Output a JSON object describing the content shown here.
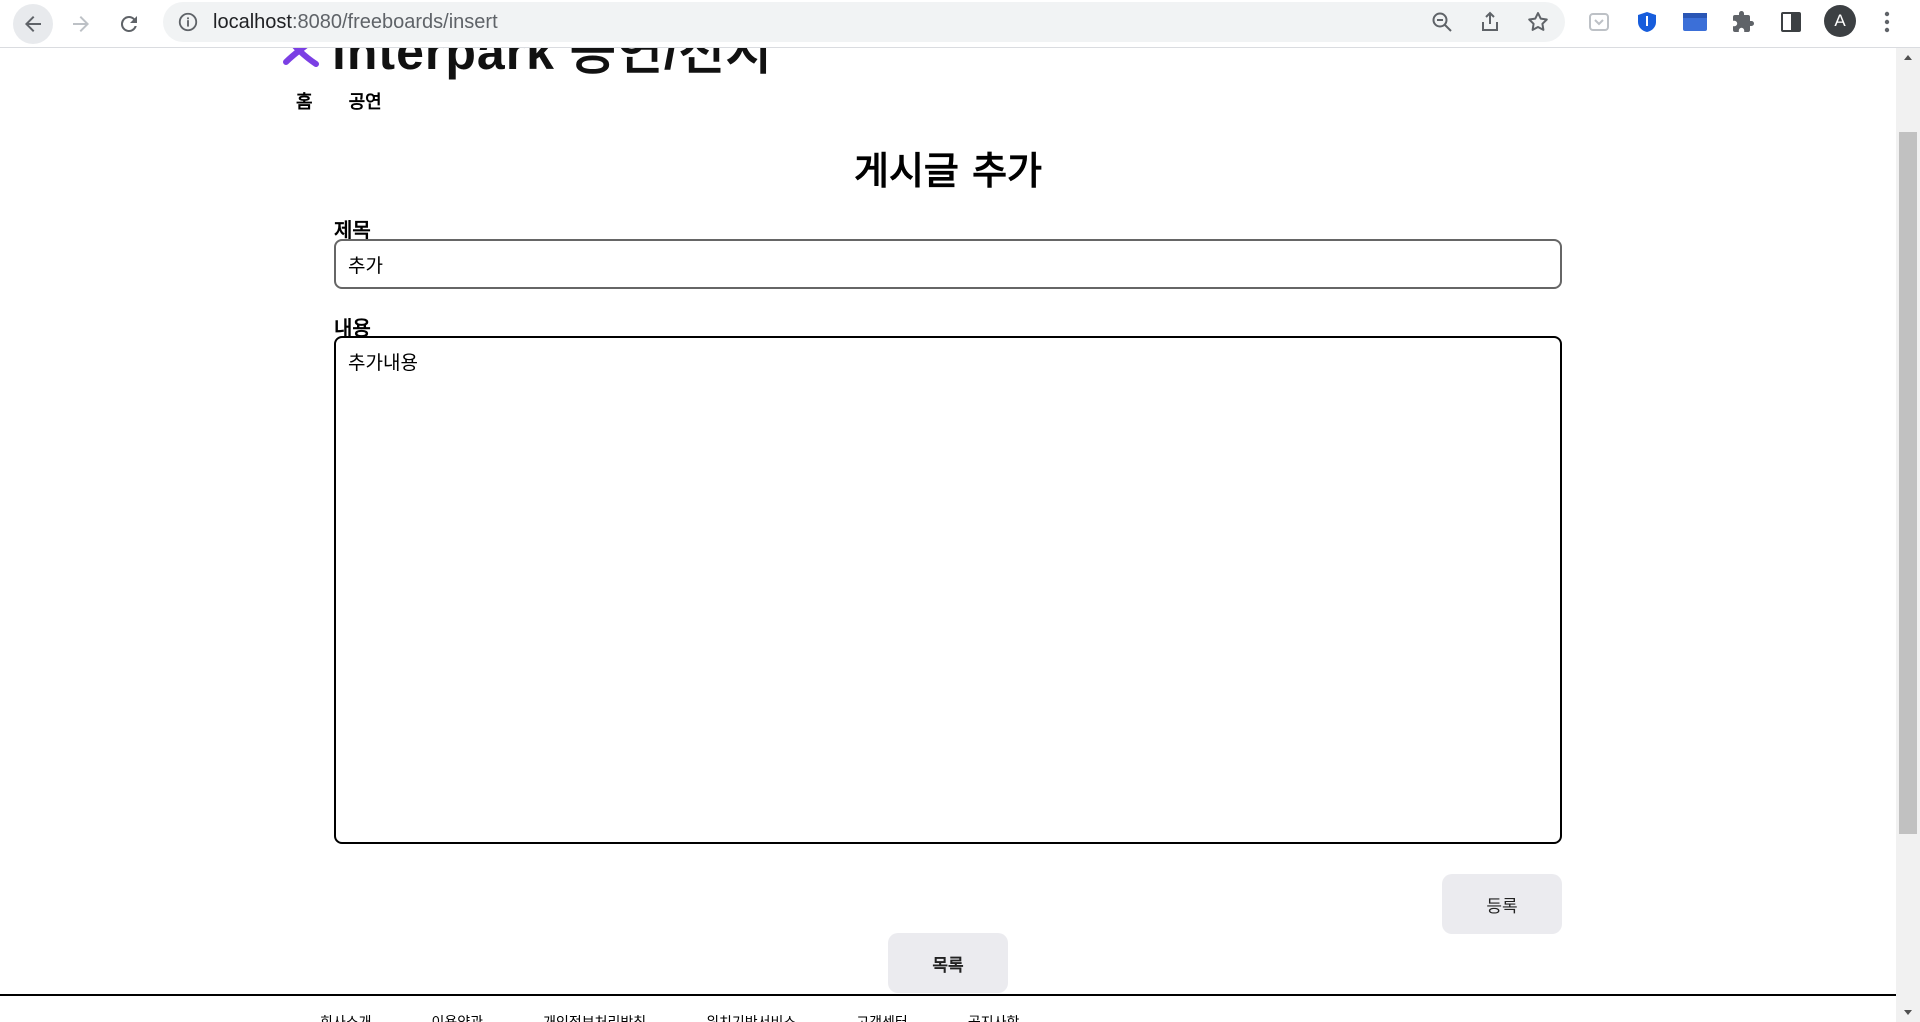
{
  "browser": {
    "url_host": "localhost",
    "url_path": ":8080/freeboards/insert",
    "profile_initial": "A"
  },
  "site": {
    "logo_text": "interpark 공연/전시",
    "nav": [
      "홈",
      "공연"
    ]
  },
  "form": {
    "page_title": "게시글 추가",
    "title_label": "제목",
    "title_value": "추가",
    "content_label": "내용",
    "content_value": "추가내용",
    "submit_label": "등록",
    "list_label": "목록"
  },
  "footer": {
    "links": [
      "회사소개",
      "이용약관",
      "개인정보처리방침",
      "위치기반서비스",
      "고객센터",
      "공지사항"
    ]
  },
  "colors": {
    "logo_accent": "#7b3fe4",
    "button_bg": "#ebebef"
  }
}
